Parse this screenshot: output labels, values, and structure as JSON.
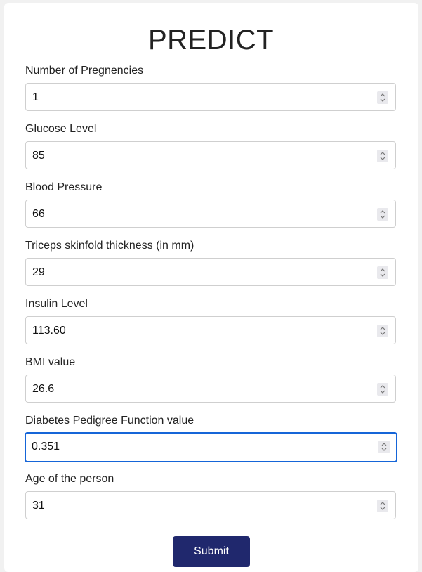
{
  "page": {
    "title": "PREDICT"
  },
  "form": {
    "fields": [
      {
        "label": "Number of Pregnencies",
        "value": "1"
      },
      {
        "label": "Glucose Level",
        "value": "85"
      },
      {
        "label": "Blood Pressure",
        "value": "66"
      },
      {
        "label": "Triceps skinfold thickness (in mm)",
        "value": "29"
      },
      {
        "label": "Insulin Level",
        "value": "113.60"
      },
      {
        "label": "BMI value",
        "value": "26.6"
      },
      {
        "label": "Diabetes Pedigree Function value",
        "value": "0.351"
      },
      {
        "label": "Age of the person",
        "value": "31"
      }
    ],
    "submit_label": "Submit"
  },
  "colors": {
    "accent": "#20286d",
    "focus_border": "#1565d8",
    "input_border": "#cfcfcf"
  },
  "icons": {
    "spinner": "number-spinner-icon"
  }
}
